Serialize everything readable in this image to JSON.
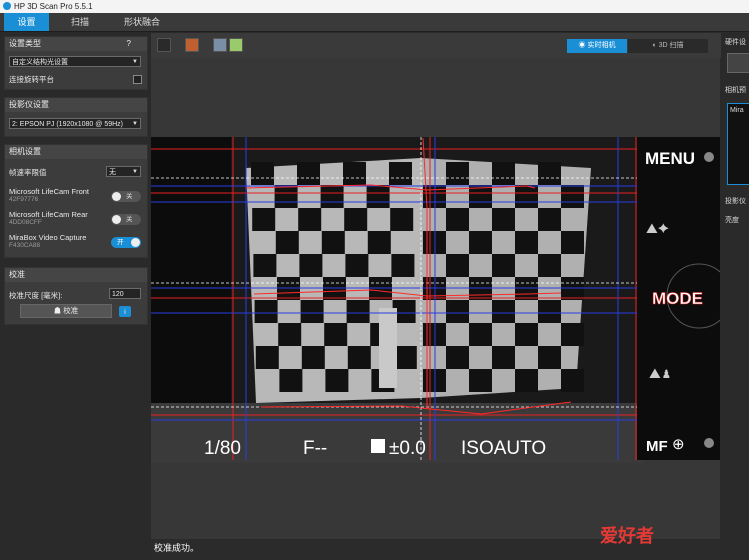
{
  "window": {
    "title": "HP 3D Scan Pro 5.5.1"
  },
  "menu": {
    "tabs": [
      {
        "label": "设置"
      },
      {
        "label": "扫描"
      },
      {
        "label": "形状融合"
      }
    ],
    "active": 0
  },
  "left": {
    "setup_type": {
      "header": "设置类型",
      "help": "?",
      "value": "自定义结构光设置",
      "turntable_label": "连接旋转平台"
    },
    "projector": {
      "header": "投影仪设置",
      "value": "2: EPSON PJ (1920x1080 @ 59Hz)"
    },
    "camera": {
      "header": "相机设置",
      "fps_label": "帧速率限值",
      "fps_value": "无",
      "devices": [
        {
          "name": "Microsoft LifeCam Front",
          "id": "42F97776",
          "state": "关"
        },
        {
          "name": "Microsoft LifeCam Rear",
          "id": "4DD08CFF",
          "state": "关"
        },
        {
          "name": "MiraBox Video Capture",
          "id": "F430CA88",
          "state": "开"
        }
      ]
    },
    "calibration": {
      "header": "校准",
      "size_label": "校准尺度 [毫米]:",
      "size_value": "120",
      "button": "校准",
      "info": "i"
    }
  },
  "viewer": {
    "live_label": "实时相机",
    "scan_label": "3D 扫描",
    "overlay": {
      "menu": "MENU",
      "mode": "MODE",
      "mf": "MF",
      "shutter": "1/80",
      "aperture": "F--",
      "exposure": "±0.0",
      "iso": "ISOAUTO"
    }
  },
  "status": "校准成功。",
  "right": {
    "h1": "硬件设",
    "h2": "相机预",
    "preview": "Mira",
    "h3": "投影仪",
    "brightness": "亮度"
  },
  "watermark": "爱好者",
  "colors": {
    "accent": "#1b8fd6",
    "grid_red": "#e82020",
    "grid_blue": "#2a3ce0"
  }
}
